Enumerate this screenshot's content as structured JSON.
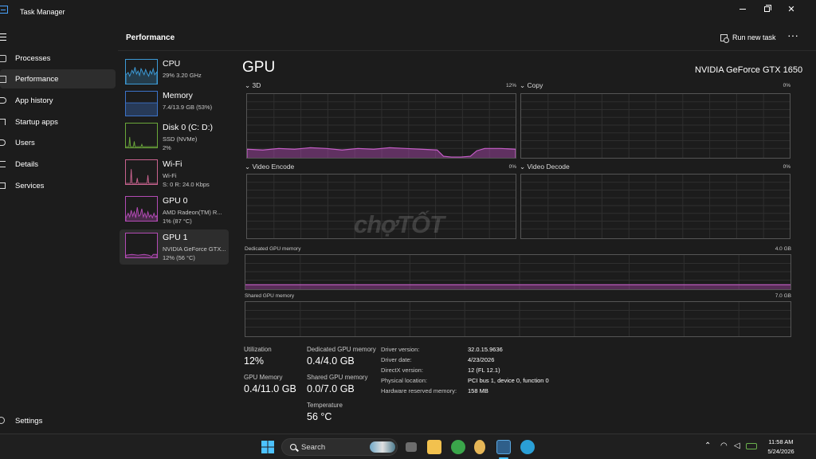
{
  "window": {
    "title": "Task Manager"
  },
  "nav": {
    "items": [
      {
        "label": "Processes",
        "icon": "grid-icon"
      },
      {
        "label": "Performance",
        "icon": "chart-icon",
        "active": true
      },
      {
        "label": "App history",
        "icon": "history-icon"
      },
      {
        "label": "Startup apps",
        "icon": "startup-icon"
      },
      {
        "label": "Users",
        "icon": "users-icon"
      },
      {
        "label": "Details",
        "icon": "list-icon"
      },
      {
        "label": "Services",
        "icon": "puzzle-icon"
      }
    ],
    "settings": "Settings"
  },
  "header": {
    "title": "Performance",
    "run_new_task": "Run new task",
    "more": "···"
  },
  "devices": [
    {
      "name": "CPU",
      "line1": "29%  3.20 GHz",
      "line2": "",
      "color": "#3c9ad6"
    },
    {
      "name": "Memory",
      "line1": "7.4/13.9 GB (53%)",
      "line2": "",
      "color": "#3c73c9"
    },
    {
      "name": "Disk 0 (C: D:)",
      "line1": "SSD (NVMe)",
      "line2": "2%",
      "color": "#6ba83a"
    },
    {
      "name": "Wi-Fi",
      "line1": "Wi-Fi",
      "line2": "S: 0  R: 24.0 Kbps",
      "color": "#c9638f"
    },
    {
      "name": "GPU 0",
      "line1": "AMD Radeon(TM) R...",
      "line2": "1% (87 °C)",
      "color": "#b34bb5"
    },
    {
      "name": "GPU 1",
      "line1": "NVIDIA GeForce GTX...",
      "line2": "12% (56 °C)",
      "color": "#b34bb5",
      "selected": true
    }
  ],
  "gpu": {
    "title": "GPU",
    "model": "NVIDIA GeForce GTX 1650",
    "engines": [
      {
        "label": "3D",
        "pct": "12%"
      },
      {
        "label": "Copy",
        "pct": "0%"
      },
      {
        "label": "Video Encode",
        "pct": "0%"
      },
      {
        "label": "Video Decode",
        "pct": "0%"
      }
    ],
    "dedicated_label": "Dedicated GPU memory",
    "dedicated_max": "4.0 GB",
    "shared_label": "Shared GPU memory",
    "shared_max": "7.0 GB",
    "accent": "#b34bb5"
  },
  "stats": {
    "utilization_label": "Utilization",
    "utilization": "12%",
    "dedicated_label": "Dedicated GPU memory",
    "dedicated": "0.4/4.0 GB",
    "gpu_memory_label": "GPU Memory",
    "gpu_memory": "0.4/11.0 GB",
    "shared_label": "Shared GPU memory",
    "shared": "0.0/7.0 GB",
    "temperature_label": "Temperature",
    "temperature": "56 °C"
  },
  "info": [
    {
      "label": "Driver version:",
      "value": "32.0.15.9636"
    },
    {
      "label": "Driver date:",
      "value": "4/23/2026"
    },
    {
      "label": "DirectX version:",
      "value": "12 (FL 12.1)"
    },
    {
      "label": "Physical location:",
      "value": "PCI bus 1, device 0, function 0"
    },
    {
      "label": "Hardware reserved memory:",
      "value": "158 MB"
    }
  ],
  "watermark": "chợTỐT",
  "taskbar": {
    "search": "Search",
    "time": "11:58 AM",
    "date": "5/24/2026"
  }
}
